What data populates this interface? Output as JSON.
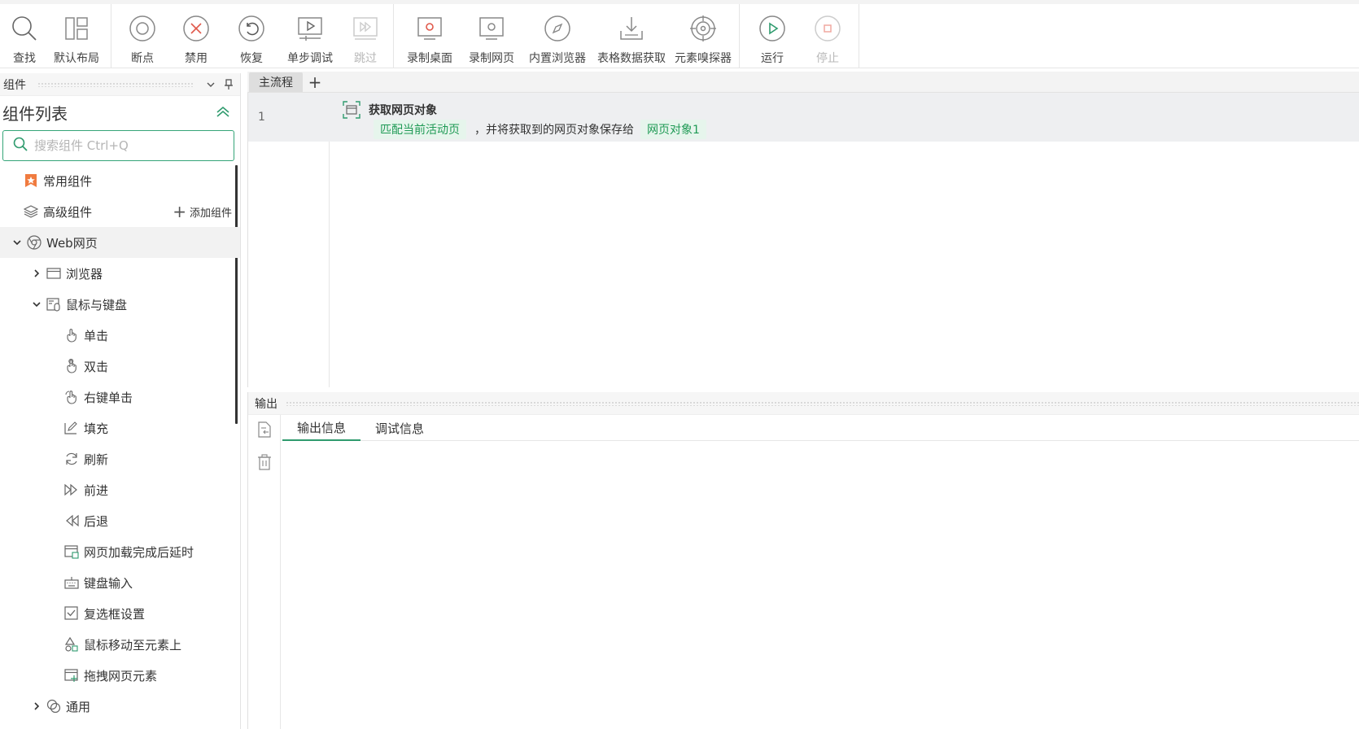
{
  "toolbar": {
    "find": "查找",
    "default_layout": "默认布局",
    "breakpoint": "断点",
    "disable": "禁用",
    "restore": "恢复",
    "step_debug": "单步调试",
    "skip": "跳过",
    "record_desktop": "录制桌面",
    "record_web": "录制网页",
    "builtin_browser": "内置浏览器",
    "table_data": "表格数据获取",
    "element_sniffer": "元素嗅探器",
    "run": "运行",
    "stop": "停止"
  },
  "left_panel": {
    "header": "组件",
    "list_title": "组件列表",
    "search_placeholder": "搜索组件 Ctrl+Q",
    "common": "常用组件",
    "advanced": "高级组件",
    "add_component": "添加组件",
    "web": "Web网页",
    "browser": "浏览器",
    "mouse_keyboard": "鼠标与键盘",
    "items": [
      "单击",
      "双击",
      "右键单击",
      "填充",
      "刷新",
      "前进",
      "后退",
      "网页加载完成后延时",
      "键盘输入",
      "复选框设置",
      "鼠标移动至元素上",
      "拖拽网页元素"
    ],
    "general": "通用"
  },
  "main": {
    "tab": "主流程",
    "tab_add": "+",
    "line_no": "1",
    "step_title": "获取网页对象",
    "chip1": "匹配当前活动页",
    "mid_text": "，并将获取到的网页对象保存给",
    "chip2": "网页对象1"
  },
  "output": {
    "header": "输出",
    "tab_output": "输出信息",
    "tab_debug": "调试信息"
  },
  "colors": {
    "accent": "#2f9b6e",
    "danger": "#e0584a",
    "chip_bg": "#e6f5ec",
    "chip_text": "#1f9a55"
  }
}
